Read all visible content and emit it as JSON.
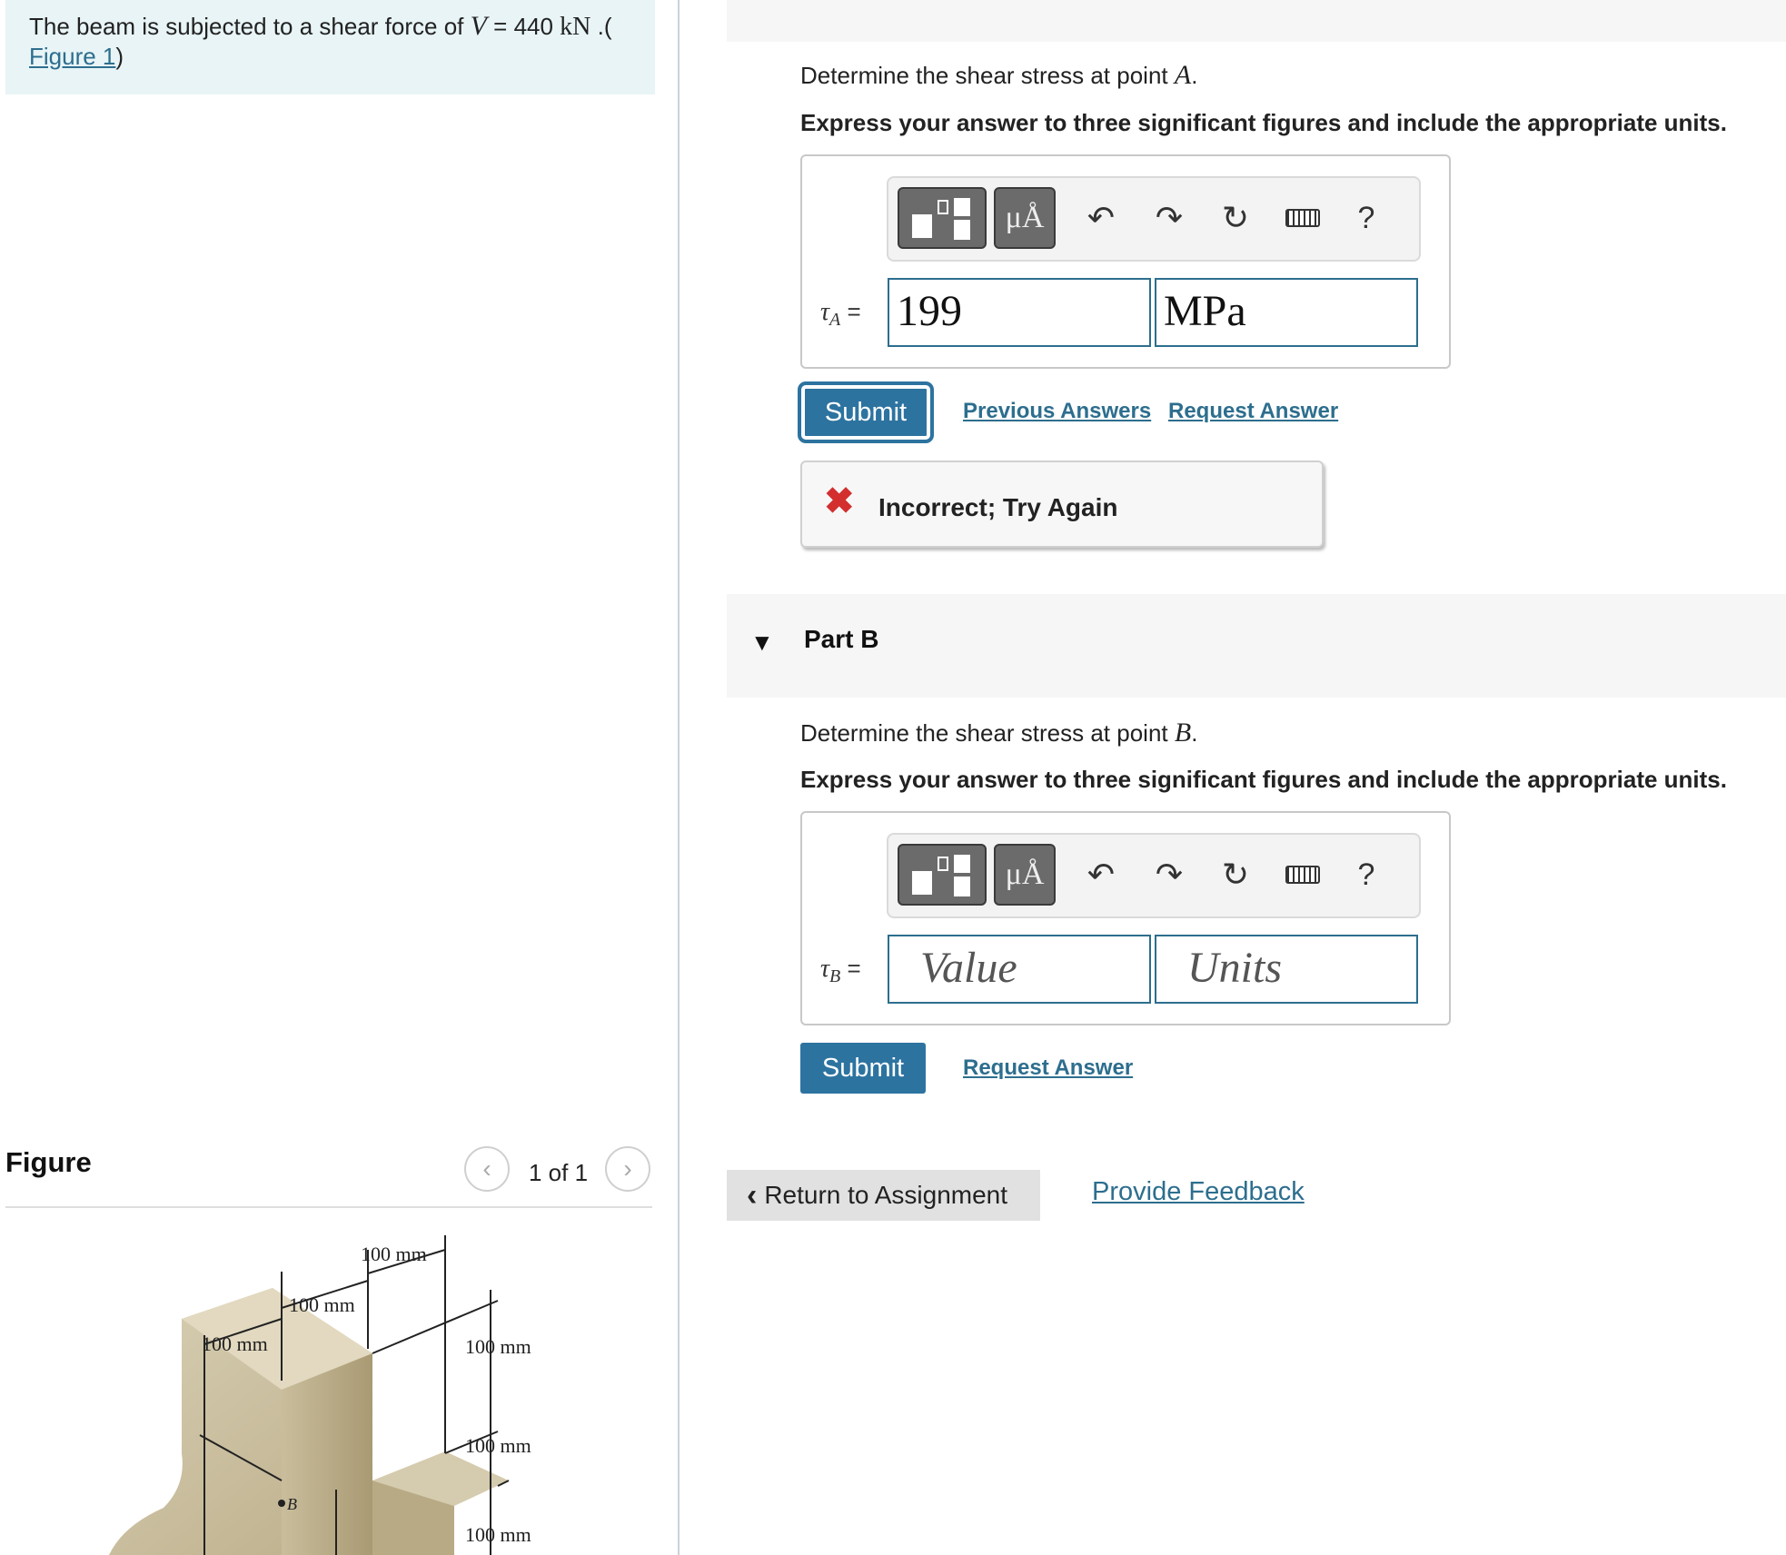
{
  "problem": {
    "text_prefix": "The beam is subjected to a shear force of ",
    "variable": "V",
    "equals": " = 440 ",
    "unit": "kN",
    "text_suffix": " .(",
    "figure_link": "Figure 1",
    "close_paren": ")"
  },
  "figure_panel": {
    "title": "Figure",
    "counter": "1 of 1",
    "prev_icon": "chevron-left-icon",
    "next_icon": "chevron-right-icon",
    "dims": [
      "100 mm",
      "100 mm",
      "100 mm",
      "100 mm",
      "100 mm",
      "100 mm"
    ],
    "point_label": "B"
  },
  "part_a": {
    "question_prefix": "Determine the shear stress at point ",
    "point": "A",
    "question_suffix": ".",
    "instruction": "Express your answer to three significant figures and include the appropriate units.",
    "var_symbol": "τ",
    "var_sub": "A",
    "equals": " =",
    "value": "199",
    "units": "MPa",
    "submit_label": "Submit",
    "previous_answers": "Previous Answers",
    "request_answer": "Request Answer",
    "feedback": "Incorrect; Try Again",
    "feedback_icon": "x-mark-icon",
    "feedback_color": "#d32f2f"
  },
  "toolbar": {
    "mu_label": "μÅ",
    "help_label": "?",
    "icons": [
      "templates-icon",
      "units-icon",
      "undo-icon",
      "redo-icon",
      "reset-icon",
      "keyboard-icon",
      "help-icon"
    ]
  },
  "part_b": {
    "header": "Part B",
    "question_prefix": "Determine the shear stress at point ",
    "point": "B",
    "question_suffix": ".",
    "instruction": "Express your answer to three significant figures and include the appropriate units.",
    "var_symbol": "τ",
    "var_sub": "B",
    "equals": " =",
    "value_placeholder": "Value",
    "units_placeholder": "Units",
    "submit_label": "Submit",
    "request_answer": "Request Answer"
  },
  "footer": {
    "return_label": "Return to Assignment",
    "feedback_link": "Provide Feedback"
  },
  "colors": {
    "accent": "#2d73a0",
    "link": "#2d6e8e",
    "problem_bg": "#e8f4f6"
  }
}
